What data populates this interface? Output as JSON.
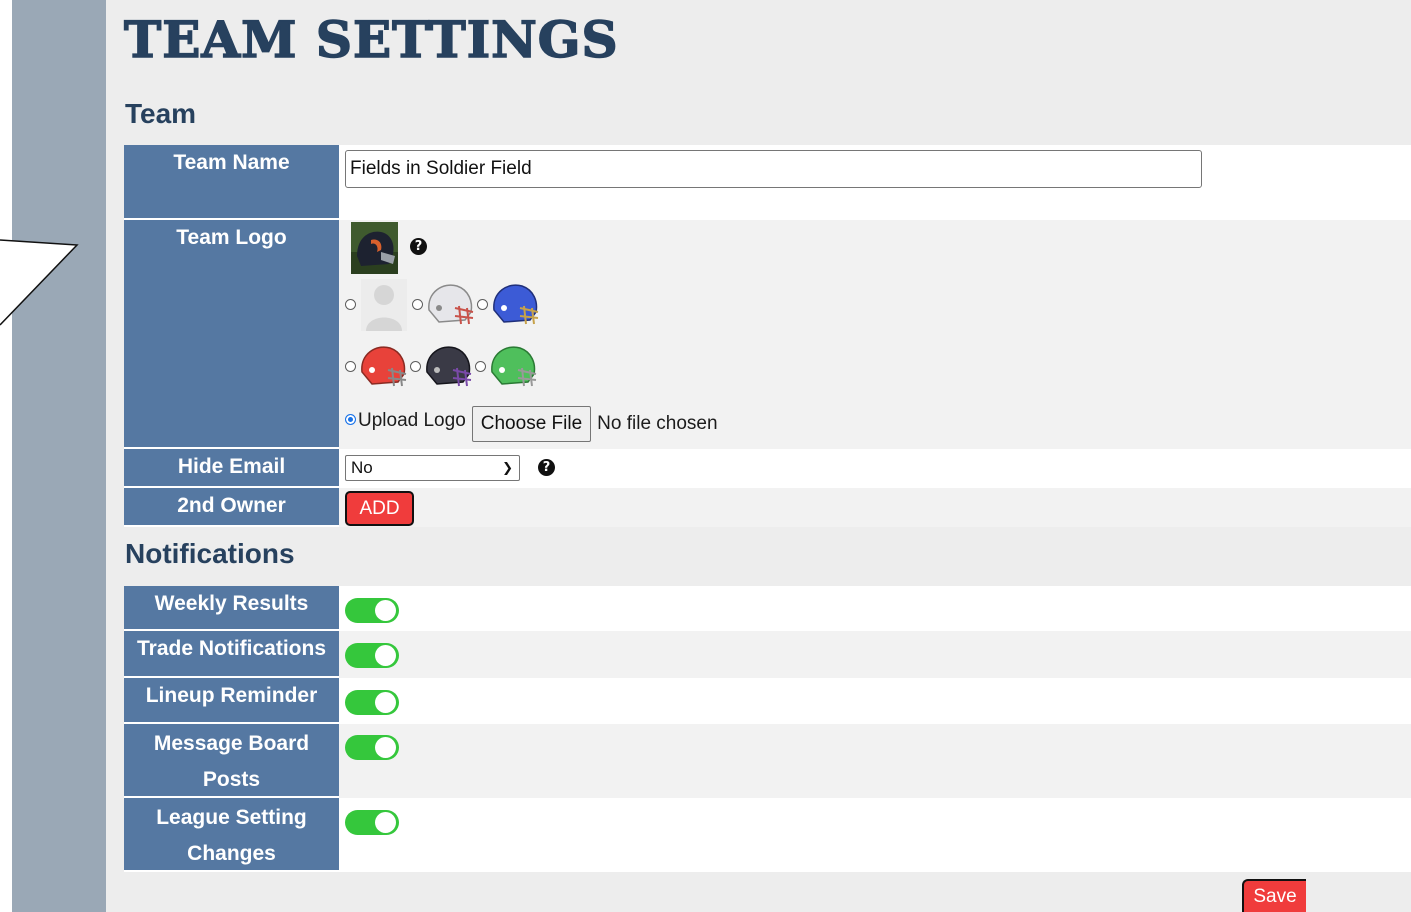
{
  "page": {
    "title": "TEAM SETTINGS",
    "save_label": "Save"
  },
  "team": {
    "heading": "Team",
    "team_name_label": "Team Name",
    "team_name_value": "Fields in Soldier Field",
    "team_logo_label": "Team Logo",
    "logo_help": "?",
    "upload_label": "Upload Logo",
    "choose_file_label": "Choose File",
    "no_file_text": "No file chosen",
    "hide_email_label": "Hide Email",
    "hide_email_value": "No",
    "hide_email_help": "?",
    "second_owner_label": "2nd Owner",
    "add_label": "ADD",
    "helmet_colors": [
      "#e8e8ec",
      "#3c5bd6",
      "#e8423a",
      "#3a3a46",
      "#4fbf5c"
    ]
  },
  "notifications": {
    "heading": "Notifications",
    "items": [
      {
        "label": "Weekly Results",
        "enabled": true
      },
      {
        "label": "Trade Notifications",
        "enabled": true
      },
      {
        "label": "Lineup Reminder",
        "enabled": true
      },
      {
        "label": "Message Board Posts",
        "enabled": true
      },
      {
        "label": "League Setting Changes",
        "enabled": true
      }
    ]
  },
  "colors": {
    "label_bg": "#5578a2",
    "heading": "#27415e",
    "toggle_on": "#35c73c",
    "danger": "#f03c3c"
  }
}
